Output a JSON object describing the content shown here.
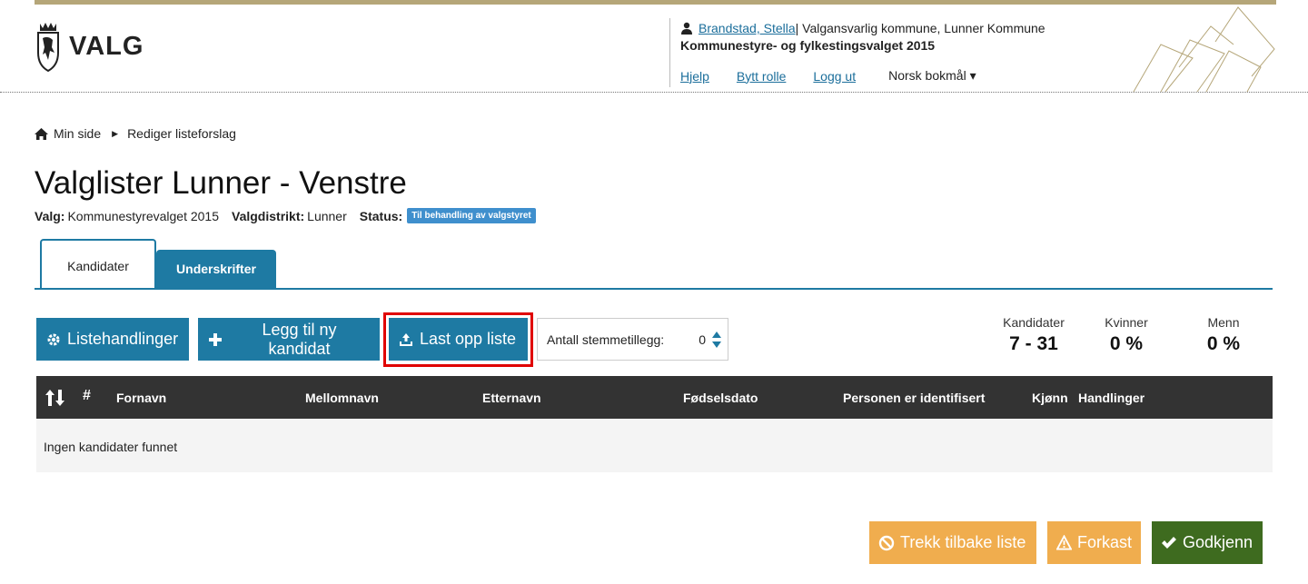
{
  "header": {
    "logo_text": "VALG",
    "user_name": "Brandstad, Stella",
    "role_text": " | Valgansvarlig kommune, Lunner Kommune",
    "election_title": "Kommunestyre- og fylkestingsvalget 2015",
    "links": {
      "help": "Hjelp",
      "switch_role": "Bytt rolle",
      "logout": "Logg ut"
    },
    "language": "Norsk bokmål ▾"
  },
  "breadcrumb": {
    "home": "Min side",
    "sep": "▶",
    "current": "Rediger listeforslag"
  },
  "page": {
    "title": "Valglister Lunner - Venstre",
    "meta": {
      "valg_label": "Valg:",
      "valg_value": "Kommunestyrevalget 2015",
      "distrikt_label": "Valgdistrikt:",
      "distrikt_value": "Lunner",
      "status_label": "Status:",
      "status_value": "Til behandling av valgstyret"
    }
  },
  "tabs": {
    "active": "Kandidater",
    "inactive": "Underskrifter"
  },
  "toolbar": {
    "actions_label": "Listehandlinger",
    "add_label": "Legg til ny kandidat",
    "upload_label": "Last opp liste",
    "stemme_label": "Antall stemmetillegg:",
    "stemme_value": "0"
  },
  "stats": [
    {
      "label": "Kandidater",
      "value": "7 - 31"
    },
    {
      "label": "Kvinner",
      "value": "0 %"
    },
    {
      "label": "Menn",
      "value": "0 %"
    }
  ],
  "table": {
    "columns": [
      "#",
      "Fornavn",
      "Mellomnavn",
      "Etternavn",
      "Fødselsdato",
      "Personen er identifisert",
      "Kjønn",
      "Handlinger"
    ],
    "empty_text": "Ingen kandidater funnet"
  },
  "footer": {
    "withdraw_label": "Trekk tilbake liste",
    "reject_label": "Forkast",
    "approve_label": "Godkjenn"
  },
  "colors": {
    "primary": "#1e7aa3",
    "warning": "#f0ad4e",
    "success": "#3e6b1f",
    "table_header": "#333333",
    "highlight": "#e00000",
    "topbar": "#b5a679"
  }
}
